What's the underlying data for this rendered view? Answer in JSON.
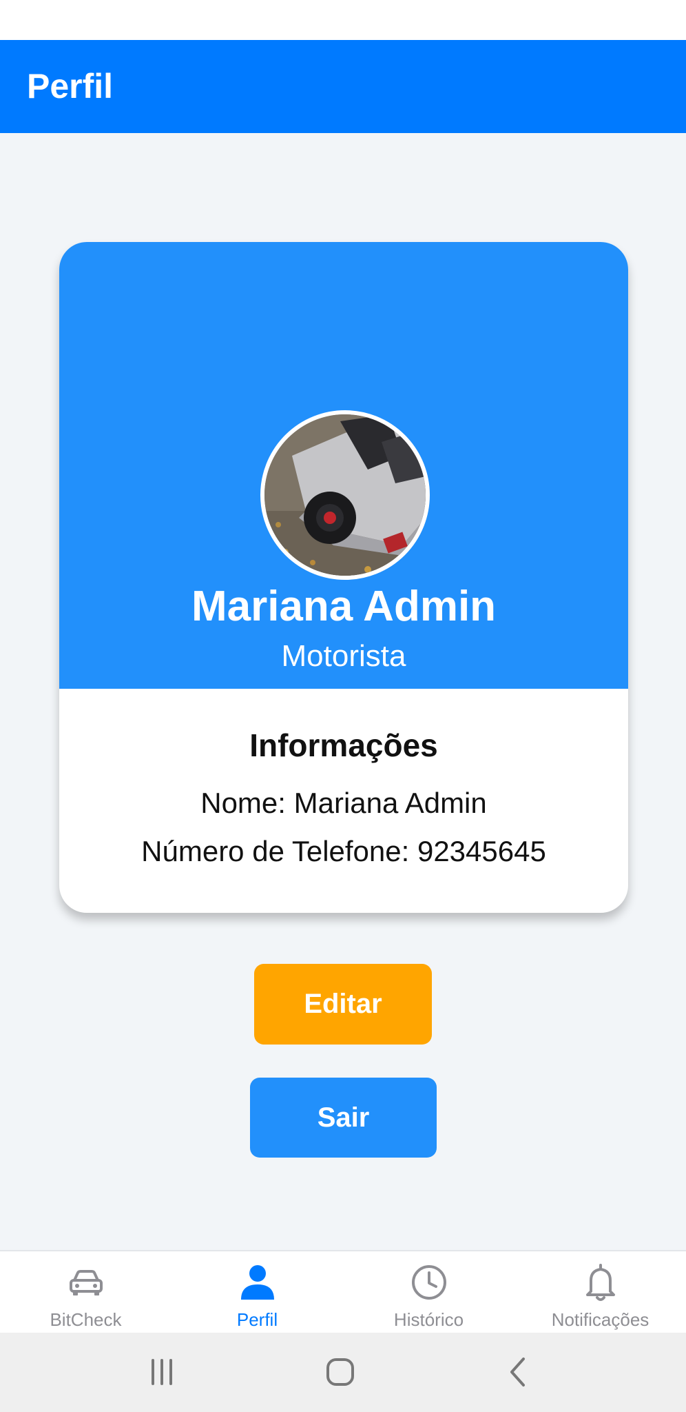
{
  "header": {
    "title": "Perfil"
  },
  "profile": {
    "name": "Mariana Admin",
    "role": "Motorista",
    "avatar_icon": "car-photo-avatar"
  },
  "info": {
    "title": "Informações",
    "name_line": "Nome: Mariana Admin",
    "phone_line": "Número de Telefone: 92345645"
  },
  "actions": {
    "edit_label": "Editar",
    "logout_label": "Sair"
  },
  "bottom_nav": {
    "items": [
      {
        "label": "BitCheck",
        "icon": "car-icon",
        "active": false
      },
      {
        "label": "Perfil",
        "icon": "user-icon",
        "active": true
      },
      {
        "label": "Histórico",
        "icon": "clock-icon",
        "active": false
      },
      {
        "label": "Notificações",
        "icon": "bell-icon",
        "active": false
      }
    ]
  },
  "colors": {
    "header": "#007aff",
    "card_header": "#2290fb",
    "edit_button": "#ffa500",
    "logout_button": "#2290fb",
    "nav_active": "#007aff",
    "nav_inactive": "#8e8e93",
    "background": "#f2f5f8"
  }
}
